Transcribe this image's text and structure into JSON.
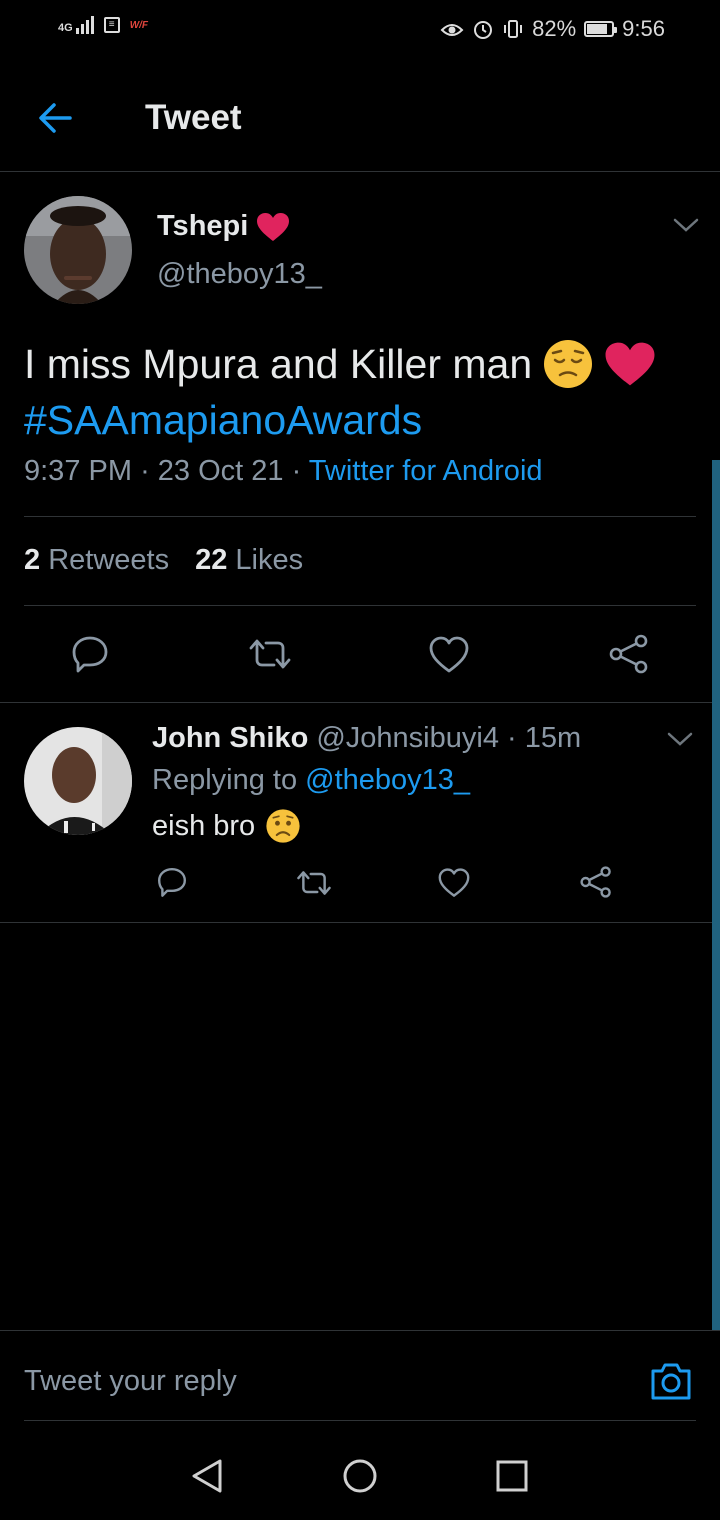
{
  "status_bar": {
    "network": "4G",
    "carrier_tag": "W/F",
    "battery": "82%",
    "battery_level": 0.82,
    "time": "9:56"
  },
  "header": {
    "title": "Tweet",
    "back_icon": "arrow-left-icon"
  },
  "tweet": {
    "author_name": "Tshepi",
    "author_handle": "@theboy13_",
    "text": "I miss Mpura and Killer man",
    "hashtag": "#SAAmapianoAwards",
    "time": "9:37 PM",
    "date": "23 Oct 21",
    "source": "Twitter for Android",
    "retweets_count": "2",
    "retweets_label": "Retweets",
    "likes_count": "22",
    "likes_label": "Likes"
  },
  "reply": {
    "author_name": "John Shiko",
    "author_handle": "@Johnsibuyi4",
    "age": "15m",
    "replying_to_label": "Replying to",
    "replying_to_handle": "@theboy13_",
    "text": "eish bro"
  },
  "compose": {
    "placeholder": "Tweet your reply"
  },
  "colors": {
    "accent": "#1d9bf0",
    "background": "#000000",
    "secondary_text": "#8b98a5",
    "like_red": "#e0245e"
  }
}
